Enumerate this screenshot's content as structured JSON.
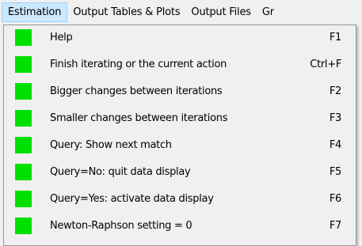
{
  "menubar": {
    "items": [
      {
        "label": "Estimation",
        "active": true
      },
      {
        "label": "Output Tables & Plots",
        "active": false
      },
      {
        "label": "Output Files",
        "active": false
      },
      {
        "label": "Gr",
        "active": false
      }
    ]
  },
  "dropdown": {
    "swatch_color": "#00e000",
    "highlight_color": "#cce8ff",
    "items": [
      {
        "label": "Help",
        "shortcut": "F1"
      },
      {
        "label": "Finish iterating or the current action",
        "shortcut": "Ctrl+F"
      },
      {
        "label": "Bigger changes between iterations",
        "shortcut": "F2"
      },
      {
        "label": "Smaller changes between iterations",
        "shortcut": "F3"
      },
      {
        "label": "Query: Show next match",
        "shortcut": "F4"
      },
      {
        "label": "Query=No: quit data display",
        "shortcut": "F5"
      },
      {
        "label": "Query=Yes: activate data display",
        "shortcut": "F6"
      },
      {
        "label": "Newton-Raphson setting = 0",
        "shortcut": "F7"
      }
    ]
  }
}
